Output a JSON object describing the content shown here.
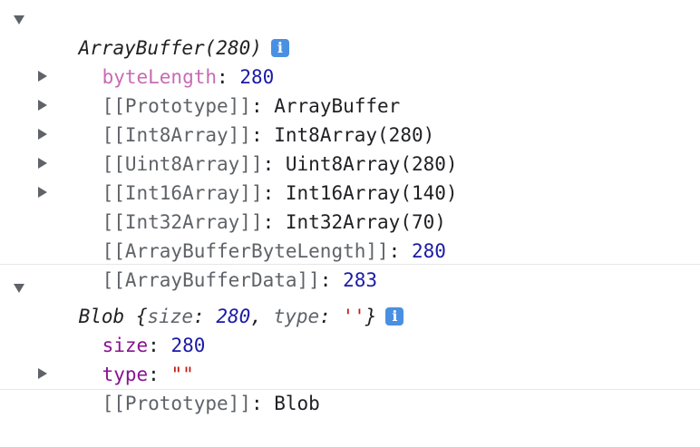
{
  "console": {
    "array_buffer": {
      "summary": "ArrayBuffer(280)",
      "info_glyph": "i",
      "byte_length": {
        "key": "byteLength",
        "value": "280"
      },
      "prototype": {
        "key": "[[Prototype]]",
        "value": "ArrayBuffer"
      },
      "int8": {
        "key": "[[Int8Array]]",
        "value": "Int8Array(280)"
      },
      "uint8": {
        "key": "[[Uint8Array]]",
        "value": "Uint8Array(280)"
      },
      "int16": {
        "key": "[[Int16Array]]",
        "value": "Int16Array(140)"
      },
      "int32": {
        "key": "[[Int32Array]]",
        "value": "Int32Array(70)"
      },
      "ab_byte_length": {
        "key": "[[ArrayBufferByteLength]]",
        "value": "280"
      },
      "ab_data": {
        "key": "[[ArrayBufferData]]",
        "value": "283"
      }
    },
    "blob": {
      "name": "Blob",
      "open_brace": "{",
      "size_key": "size",
      "size_value": "280",
      "type_key": "type",
      "type_value": "''",
      "close_brace": "}",
      "info_glyph": "i",
      "size": {
        "key": "size",
        "value": "280"
      },
      "type": {
        "key": "type",
        "value": "\"\""
      },
      "prototype": {
        "key": "[[Prototype]]",
        "value": "Blob"
      }
    }
  }
}
